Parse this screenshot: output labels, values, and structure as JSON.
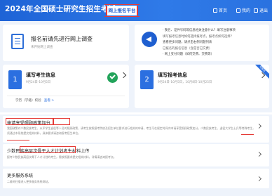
{
  "header": {
    "title": "2024年全国硕士研究生招生考试",
    "platform_badge": "网上报名平台",
    "nav": [
      {
        "label": "首页",
        "icon": "home-icon"
      },
      {
        "label": "我的",
        "icon": "user-icon"
      },
      {
        "label": "退出",
        "icon": "logout-icon"
      }
    ]
  },
  "survey": {
    "title": "报名前请先进行网上调查",
    "subtitle": "未开始网上调查"
  },
  "notice": {
    "lines": [
      "· 我名、证件号码等信息相关注意什么？填写注意事项",
      "填写报考信息时如何选择报考点，报考点如何选择？",
      "查看更多问题，请点击右侧问题列表",
      "已报名的报名信息（含是否已交费）",
      "· 网上支付问题（如何交费、交费等）"
    ]
  },
  "steps": [
    {
      "num": "1",
      "title": "填写考生信息",
      "date": "9月24日-10月5日",
      "foot_label": "学历（学籍）校验",
      "foot_action": "查看 >",
      "status": "done"
    },
    {
      "num": "2",
      "title": "填写报考信息",
      "date": "9月24日-10月5日，10月8日-10月25日",
      "ribbon": "可报名"
    }
  ],
  "services": [
    {
      "title": "申请享受照顾政策加分",
      "title_b": "照顾政策",
      "desc": "我国政策对少数民族考生、从军学生退役等人员的照顾政策，请考生按照报考院校及招生单位要求进行相关的申请，考生可在规定时间内申请享受照顾政策加分。少数民族考生、退役大学生士兵等特殊考生，须通过本系统提交相关材料，具体要求请咨询报考招生单位。",
      "link": "少数民族考生"
    },
    {
      "title": "少数民族高层次骨干人才计划考生材料上传",
      "desc": "报考少数民族高层次骨干人才计划的考生，需按照要求提交相关材料，详情请咨询报考点。"
    },
    {
      "title": "更多服务系统",
      "desc": "二维码扫描进入更多服务系统网站。"
    }
  ]
}
